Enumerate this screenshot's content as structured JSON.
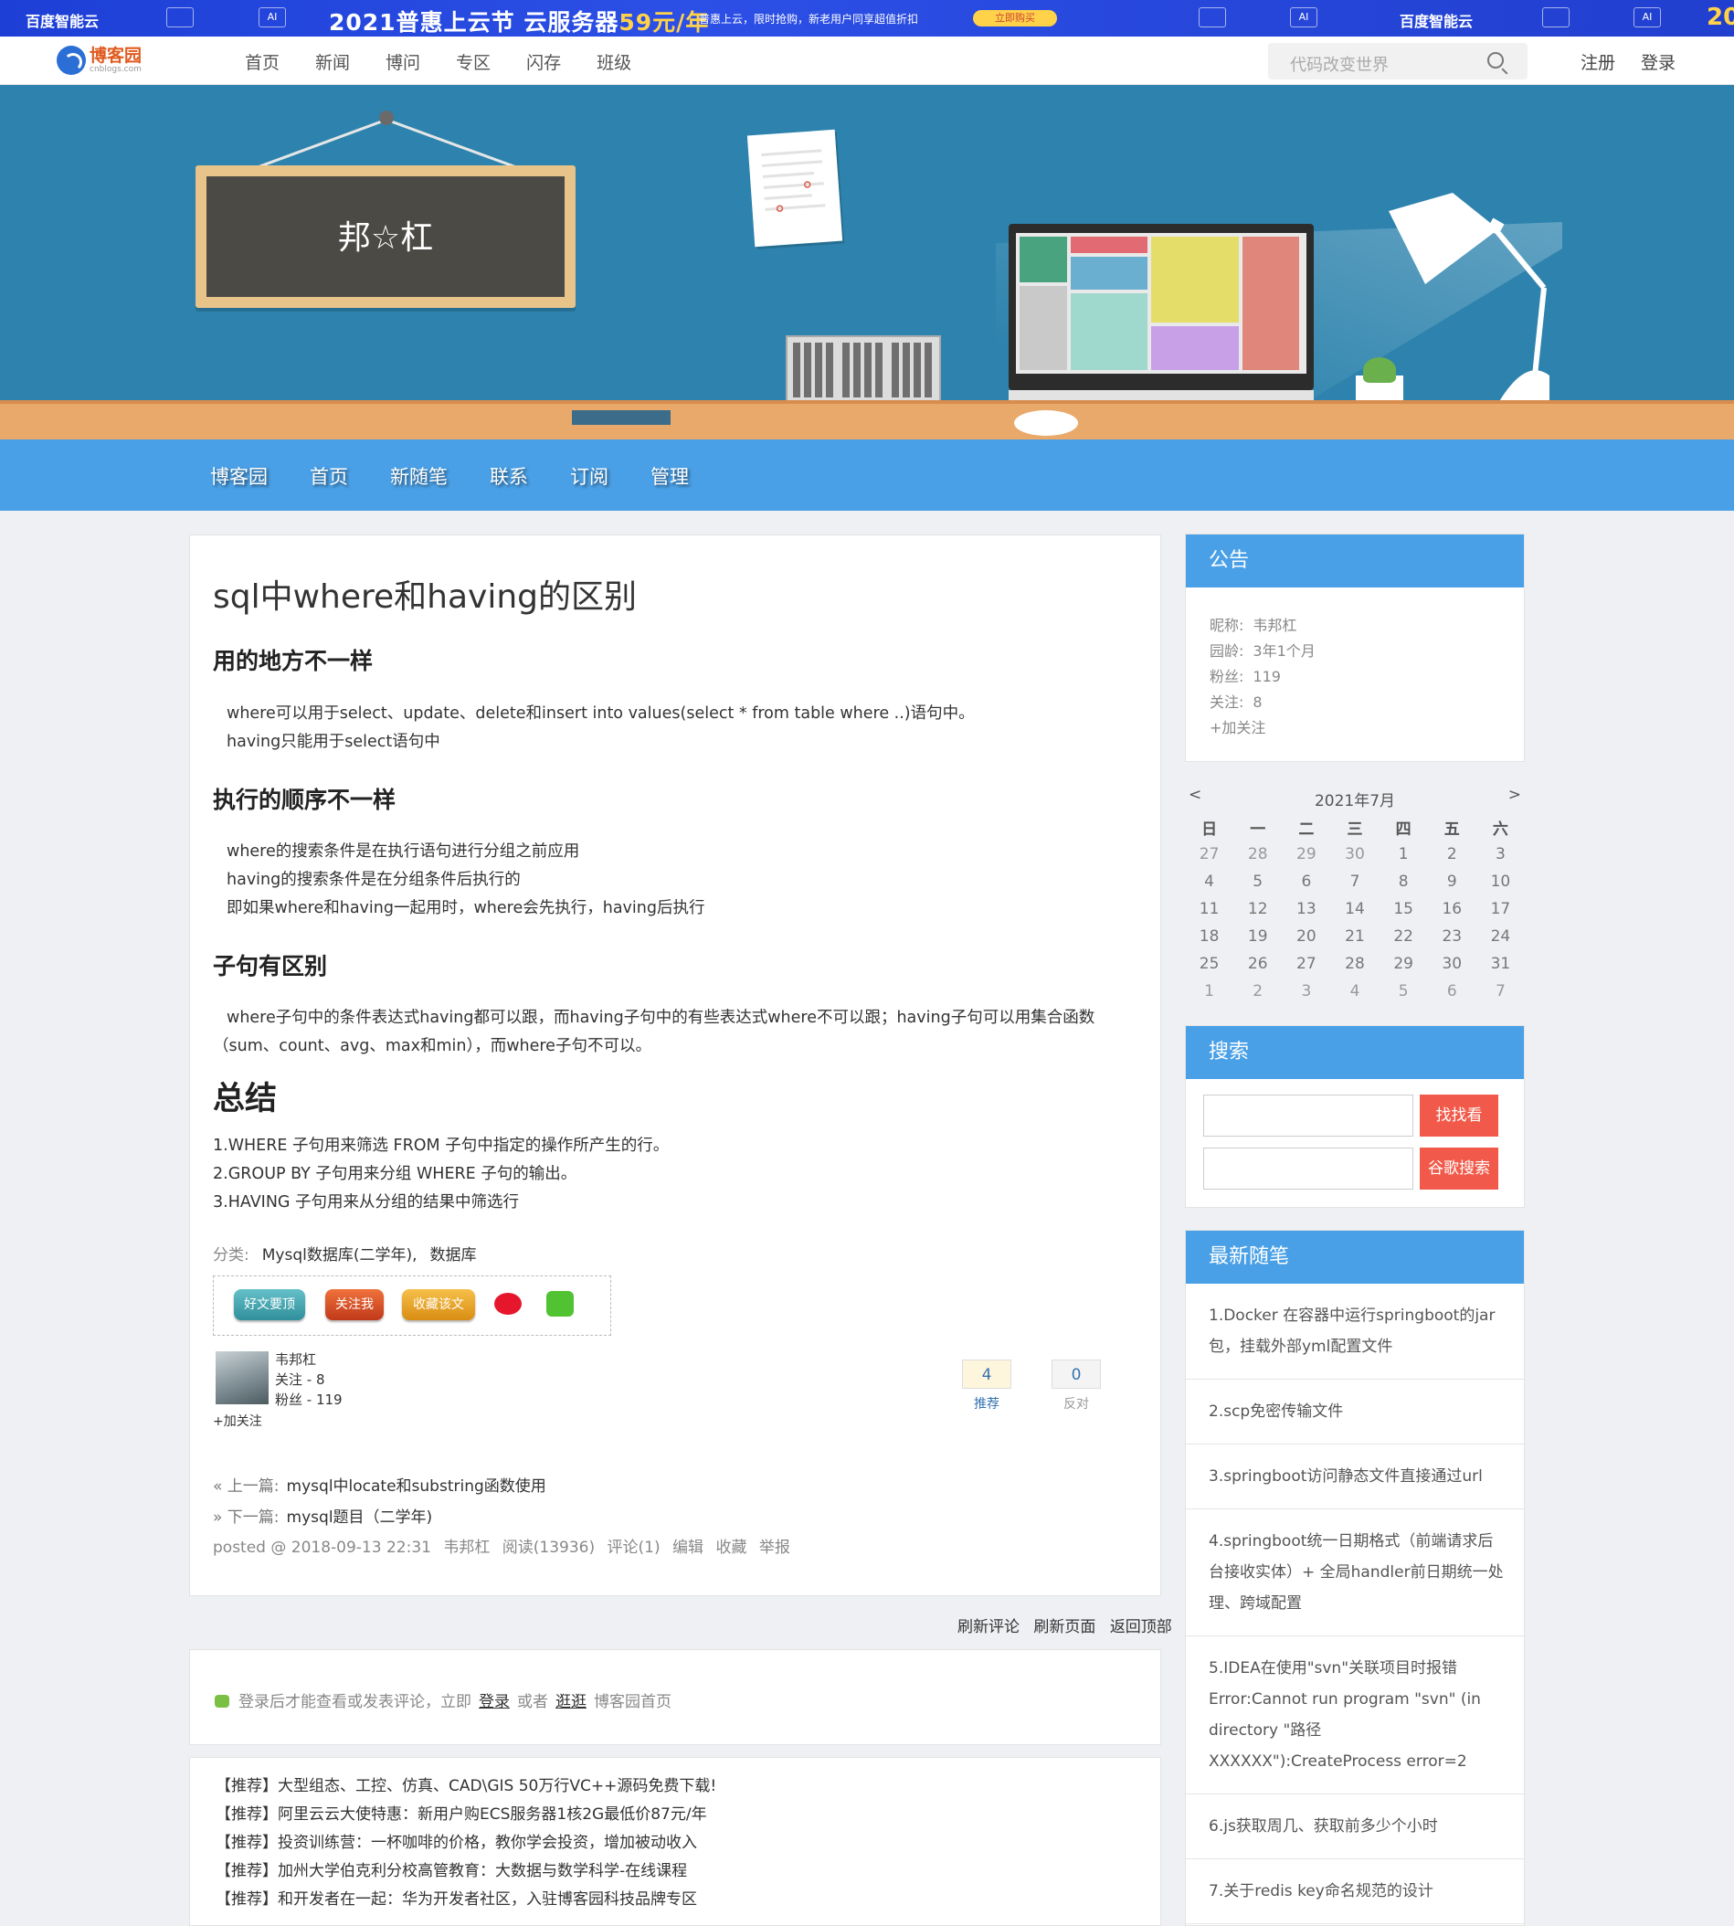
{
  "ad": {
    "brand": "百度智能云",
    "chip": "AI",
    "headline_a": "2021普惠上云节",
    "headline_b": "云服务器",
    "headline_price": "59元/年",
    "sub": "普惠上云，限时抢购，新老用户同享超值折扣",
    "cta": "立即购买",
    "tail": "20"
  },
  "topnav": {
    "logo_cn": "博客园",
    "logo_en": "cnblogs.com",
    "links": [
      "首页",
      "新闻",
      "博问",
      "专区",
      "闪存",
      "班级"
    ],
    "search_placeholder": "代码改变世界",
    "register": "注册",
    "login": "登录"
  },
  "hero": {
    "board_text": "邦☆杠"
  },
  "blognav": {
    "items": [
      "博客园",
      "首页",
      "新随笔",
      "联系",
      "订阅",
      "管理"
    ]
  },
  "post": {
    "title": "sql中where和having的区别",
    "s1_title": "用的地方不一样",
    "s1_l1": "where可以用于select、update、delete和insert into values(select * from table where ..)语句中。",
    "s1_l2": "having只能用于select语句中",
    "s2_title": "执行的顺序不一样",
    "s2_l1": "where的搜索条件是在执行语句进行分组之前应用",
    "s2_l2": "having的搜索条件是在分组条件后执行的",
    "s2_l3": "即如果where和having一起用时，where会先执行，having后执行",
    "s3_title": "子句有区别",
    "s3_text": "where子句中的条件表达式having都可以跟，而having子句中的有些表达式where不可以跟；having子句可以用集合函数（sum、count、avg、max和min），而where子句不可以。",
    "sum_title": "总结",
    "sum_l1": " 1.WHERE 子句用来筛选 FROM 子句中指定的操作所产生的行。",
    "sum_l2": "2.GROUP BY 子句用来分组 WHERE 子句的输出。",
    "sum_l3": "3.HAVING 子句用来从分组的结果中筛选行",
    "category_label": "分类:",
    "category_1": "Mysql数据库(二学年),",
    "category_2": "数据库",
    "share": {
      "good": "好文要顶",
      "follow": "关注我",
      "fav": "收藏该文"
    },
    "author": {
      "name": "韦邦杠",
      "following": "关注 - 8",
      "fans": "粉丝 - 119",
      "add_follow": "+加关注"
    },
    "votes": {
      "up": "4",
      "up_label": "推荐",
      "down": "0",
      "down_label": "反对"
    },
    "prev_label": "« 上一篇:",
    "prev_title": "mysql中locate和substring函数使用",
    "next_label": "» 下一篇:",
    "next_title": "mysql题目（二学年)",
    "posted": "posted @ 2018-09-13 22:31",
    "posted_author": "韦邦杠",
    "reads": "阅读(13936)",
    "comments": "评论(1)",
    "edit": "编辑",
    "collect": "收藏",
    "report": "举报"
  },
  "cmd": {
    "refresh_comments": "刷新评论",
    "refresh_page": "刷新页面",
    "back_top": "返回顶部"
  },
  "login_tip": {
    "pre": "登录后才能查看或发表评论，立即",
    "login": "登录",
    "or": "或者",
    "browse": "逛逛",
    "suffix": "博客园首页"
  },
  "recommend": [
    "【推荐】大型组态、工控、仿真、CAD\\GIS 50万行VC++源码免费下载!",
    "【推荐】阿里云云大使特惠：新用户购ECS服务器1核2G最低价87元/年",
    "【推荐】投资训练营：一杯咖啡的价格，教你学会投资，增加被动收入",
    "【推荐】加州大学伯克利分校高管教育：大数据与数学科学-在线课程",
    "【推荐】和开发者在一起：华为开发者社区，入驻博客园科技品牌专区"
  ],
  "notice": {
    "title": "公告",
    "nick_label": "昵称:",
    "nick": "韦邦杠",
    "age_label": "园龄:",
    "age": "3年1个月",
    "fans_label": "粉丝:",
    "fans": "119",
    "follow_label": "关注:",
    "follow": "8",
    "add": "+加关注"
  },
  "calendar": {
    "prev": "<",
    "next": ">",
    "month": "2021年7月",
    "weekdays": [
      "日",
      "一",
      "二",
      "三",
      "四",
      "五",
      "六"
    ],
    "weeks": [
      [
        "27",
        "28",
        "29",
        "30",
        "1",
        "2",
        "3"
      ],
      [
        "4",
        "5",
        "6",
        "7",
        "8",
        "9",
        "10"
      ],
      [
        "11",
        "12",
        "13",
        "14",
        "15",
        "16",
        "17"
      ],
      [
        "18",
        "19",
        "20",
        "21",
        "22",
        "23",
        "24"
      ],
      [
        "25",
        "26",
        "27",
        "28",
        "29",
        "30",
        "31"
      ],
      [
        "1",
        "2",
        "3",
        "4",
        "5",
        "6",
        "7"
      ]
    ]
  },
  "search_side": {
    "title": "搜索",
    "btn1": "找找看",
    "btn2": "谷歌搜索"
  },
  "recent": {
    "title": "最新随笔",
    "items": [
      "1.Docker 在容器中运行springboot的jar包，挂载外部yml配置文件",
      "2.scp免密传输文件",
      "3.springboot访问静态文件直接通过url",
      "4.springboot统一日期格式（前端请求后台接收实体）+ 全局handler前日期统一处理、跨域配置",
      "5.IDEA在使用\"svn\"关联项目时报错Error:Cannot run program \"svn\" (in directory \"路径XXXXXX\"):CreateProcess error=2",
      "6.js获取周几、获取前多少个小时",
      "7.关于redis key命名规范的设计"
    ]
  },
  "colors": {
    "accent": "#4aa0e6",
    "hero_bg": "#2d83ad",
    "search_btn": "#f15a4a",
    "link_orange": "#e05a1d"
  }
}
